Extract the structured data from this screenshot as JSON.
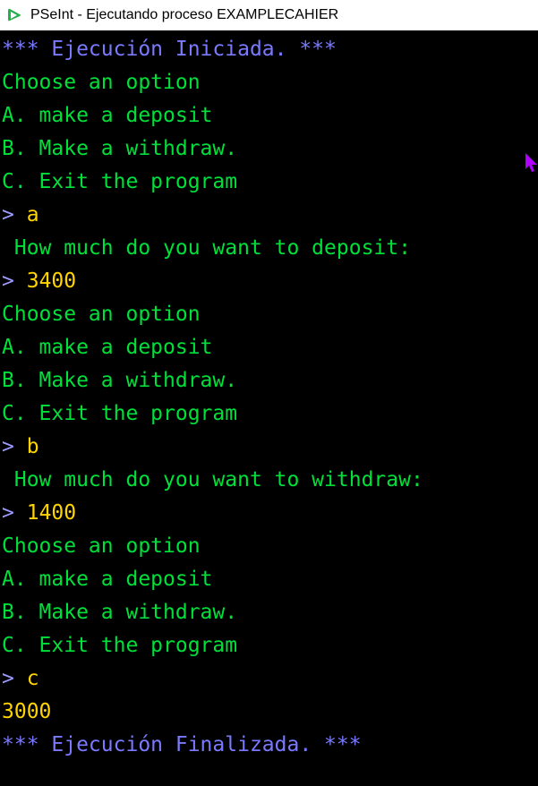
{
  "window": {
    "title": "PSeInt - Ejecutando proceso EXAMPLECAHIER",
    "app_icon": "pseint-play-icon",
    "accent": "#22b14c"
  },
  "colors": {
    "background": "#000000",
    "system": "#7a7aff",
    "output": "#00e03a",
    "prompt": "#9b9bff",
    "input": "#ffd400",
    "cursor": "#b000ff"
  },
  "console": {
    "start": "*** Ejecución Iniciada. ***",
    "menu1": {
      "title": "Choose an option",
      "a": "A. make a deposit",
      "b": "B. Make a withdraw.",
      "c": "C. Exit the program"
    },
    "prompt1": {
      "symbol": ">",
      "value": "a"
    },
    "ask_deposit": " How much do you want to deposit:",
    "prompt2": {
      "symbol": ">",
      "value": "3400"
    },
    "menu2": {
      "title": "Choose an option",
      "a": "A. make a deposit",
      "b": "B. Make a withdraw.",
      "c": "C. Exit the program"
    },
    "prompt3": {
      "symbol": ">",
      "value": "b"
    },
    "ask_withdraw": " How much do you want to withdraw:",
    "prompt4": {
      "symbol": ">",
      "value": "1400"
    },
    "menu3": {
      "title": "Choose an option",
      "a": "A. make a deposit",
      "b": "B. Make a withdraw.",
      "c": "C. Exit the program"
    },
    "prompt5": {
      "symbol": ">",
      "value": "c"
    },
    "balance": "3000",
    "end": "*** Ejecución Finalizada. ***"
  }
}
